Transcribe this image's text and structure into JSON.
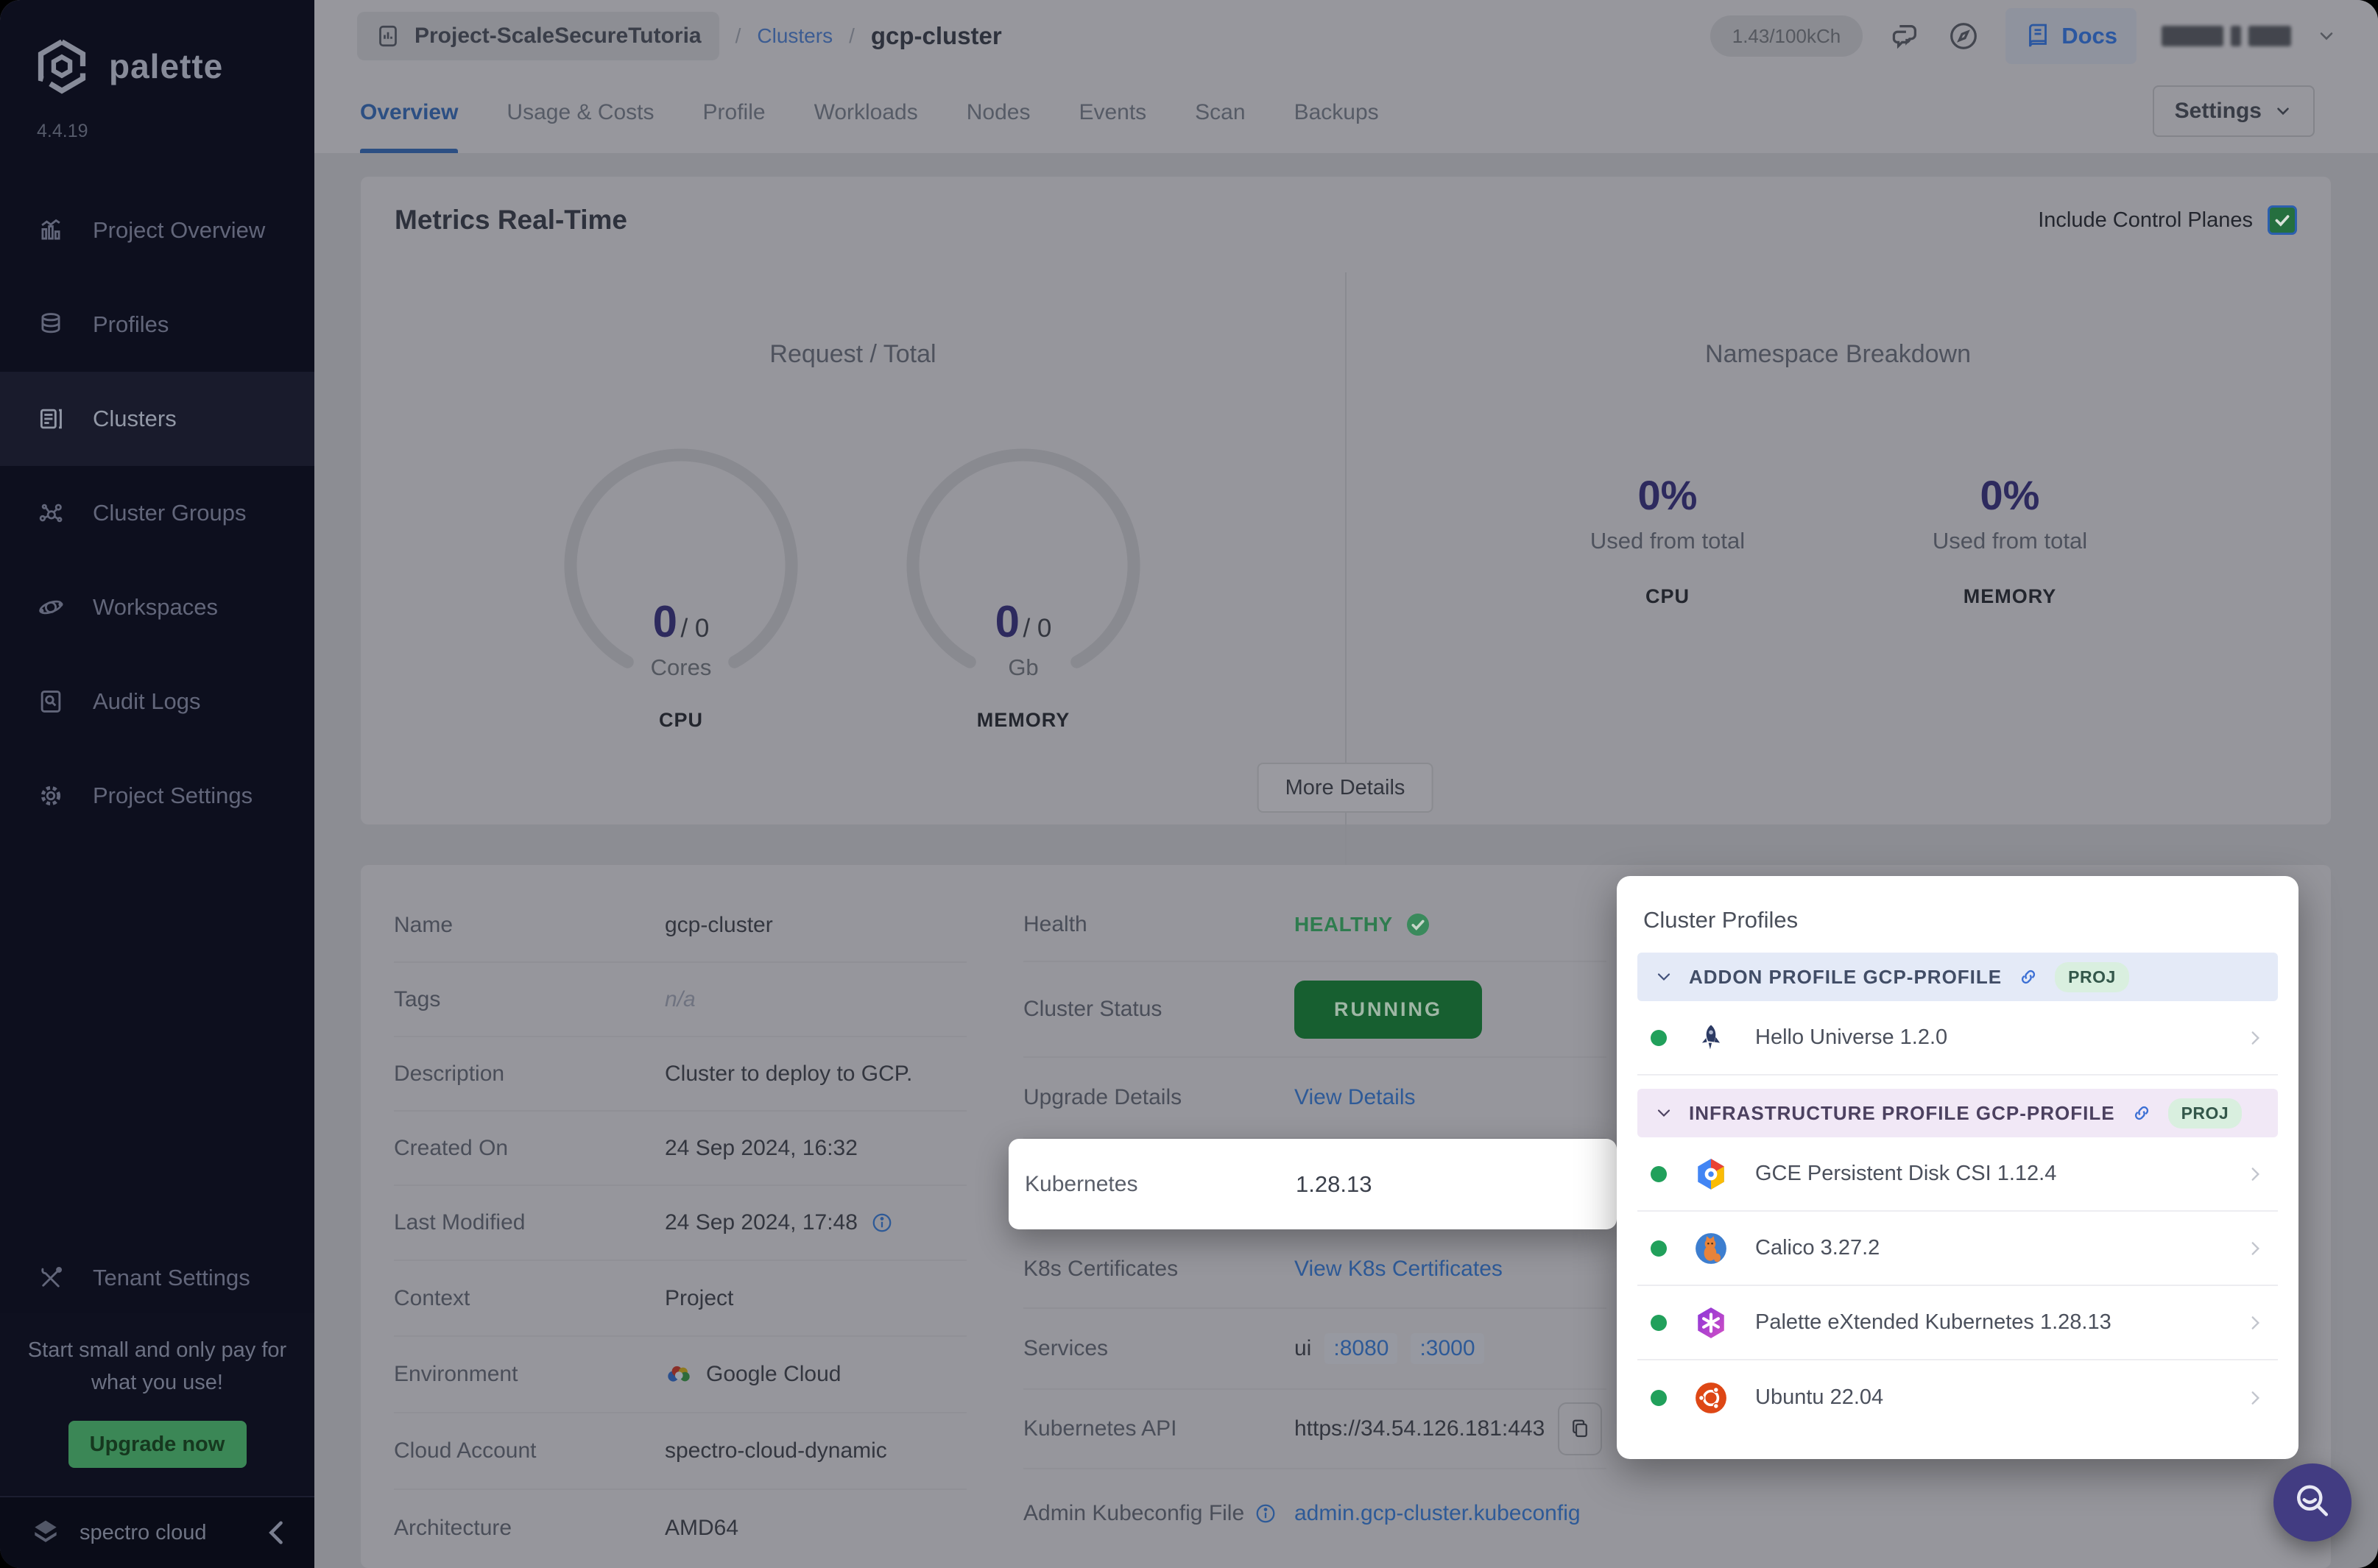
{
  "app": {
    "logo_text": "palette",
    "version": "4.4.19",
    "brand": "spectro cloud"
  },
  "sidebar": {
    "items": [
      {
        "label": "Project Overview",
        "icon": "project-overview-icon"
      },
      {
        "label": "Profiles",
        "icon": "profiles-icon"
      },
      {
        "label": "Clusters",
        "icon": "clusters-icon",
        "active": true
      },
      {
        "label": "Cluster Groups",
        "icon": "cluster-groups-icon"
      },
      {
        "label": "Workspaces",
        "icon": "workspaces-icon"
      },
      {
        "label": "Audit Logs",
        "icon": "audit-logs-icon"
      },
      {
        "label": "Project Settings",
        "icon": "project-settings-icon"
      },
      {
        "label": "Tenant Settings",
        "icon": "tenant-settings-icon"
      }
    ],
    "promo": {
      "text": "Start small and only pay for what you use!",
      "cta": "Upgrade now"
    }
  },
  "header": {
    "breadcrumb": {
      "project": "Project-ScaleSecureTutoria",
      "separator": "/",
      "section": "Clusters",
      "current": "gcp-cluster"
    },
    "usage": "1.43/100kCh",
    "docs_label": "Docs"
  },
  "tabs": {
    "items": [
      "Overview",
      "Usage & Costs",
      "Profile",
      "Workloads",
      "Nodes",
      "Events",
      "Scan",
      "Backups"
    ],
    "active": "Overview"
  },
  "settings_button": "Settings",
  "metrics": {
    "title": "Metrics Real-Time",
    "include_label": "Include Control Planes",
    "include_checked": true,
    "left_title": "Request / Total",
    "right_title": "Namespace Breakdown",
    "gauges": {
      "cpu": {
        "value": "0",
        "total": "0",
        "unit": "Cores",
        "caption": "CPU"
      },
      "memory": {
        "value": "0",
        "total": "0",
        "unit": "Gb",
        "caption": "MEMORY"
      }
    },
    "namespace": {
      "cpu": {
        "percent": "0%",
        "sub": "Used from total",
        "caption": "CPU"
      },
      "memory": {
        "percent": "0%",
        "sub": "Used from total",
        "caption": "MEMORY"
      }
    },
    "more_button": "More Details"
  },
  "details": {
    "left": [
      {
        "label": "Name",
        "value": "gcp-cluster"
      },
      {
        "label": "Tags",
        "value": "n/a"
      },
      {
        "label": "Description",
        "value": "Cluster to deploy to GCP."
      },
      {
        "label": "Created On",
        "value": "24 Sep 2024, 16:32"
      },
      {
        "label": "Last Modified",
        "value": "24 Sep 2024, 17:48"
      },
      {
        "label": "Context",
        "value": "Project"
      },
      {
        "label": "Environment",
        "value": "Google Cloud"
      },
      {
        "label": "Cloud Account",
        "value": "spectro-cloud-dynamic"
      },
      {
        "label": "Architecture",
        "value": "AMD64"
      }
    ],
    "right": {
      "health_label": "Health",
      "health_value": "HEALTHY",
      "status_label": "Cluster Status",
      "status_value": "RUNNING",
      "upgrade_label": "Upgrade Details",
      "upgrade_link": "View Details",
      "kubernetes_label": "Kubernetes",
      "kubernetes_value": "1.28.13",
      "certs_label": "K8s Certificates",
      "certs_link": "View K8s Certificates",
      "services_label": "Services",
      "services_prefix": "ui",
      "services_ports": [
        ":8080",
        ":3000"
      ],
      "api_label": "Kubernetes API",
      "api_value": "https://34.54.126.181:443",
      "kubeconfig_label": "Admin Kubeconfig File",
      "kubeconfig_link": "admin.gcp-cluster.kubeconfig"
    }
  },
  "cluster_profiles": {
    "title": "Cluster Profiles",
    "sections": [
      {
        "header": "ADDON PROFILE GCP-PROFILE",
        "badge": "PROJ",
        "items": [
          {
            "name": "Hello Universe 1.2.0",
            "icon": "hello-universe-icon"
          }
        ]
      },
      {
        "header": "INFRASTRUCTURE PROFILE GCP-PROFILE",
        "badge": "PROJ",
        "items": [
          {
            "name": "GCE Persistent Disk CSI 1.12.4",
            "icon": "gce-disk-icon"
          },
          {
            "name": "Calico 3.27.2",
            "icon": "calico-icon"
          },
          {
            "name": "Palette eXtended Kubernetes 1.28.13",
            "icon": "pxk-icon"
          },
          {
            "name": "Ubuntu 22.04",
            "icon": "ubuntu-icon"
          }
        ]
      }
    ]
  },
  "colors": {
    "link_blue": "#2e5a97",
    "healthy_green": "#2f7c4f",
    "running_bg": "#175f30",
    "metric_purple": "#2d2a5e",
    "fab_purple": "#423c82",
    "upgrade_green": "#3b8756",
    "badge_green_bg": "#d9efdf",
    "addon_header_bg": "#e4eaf7",
    "infra_header_bg": "#f1e8f6",
    "status_dot_green": "#21a05b"
  }
}
